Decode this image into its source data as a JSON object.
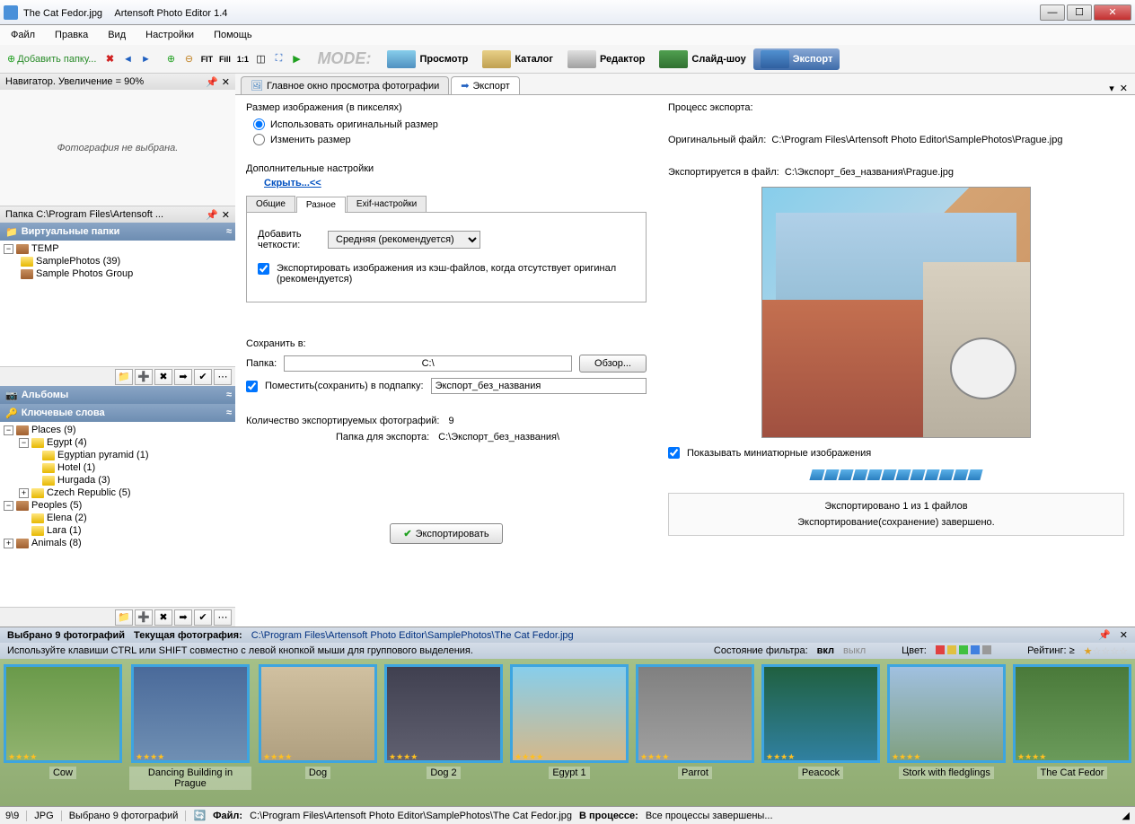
{
  "titlebar": {
    "filename": "The Cat Fedor.jpg",
    "app": "Artensoft Photo Editor 1.4"
  },
  "menu": {
    "file": "Файл",
    "edit": "Правка",
    "view": "Вид",
    "settings": "Настройки",
    "help": "Помощь"
  },
  "toolbar": {
    "add_folder": "Добавить папку...",
    "fit": "FIT",
    "fill": "Fill",
    "scale": "1:1",
    "mode": "MODE:",
    "view_mode": "Просмотр",
    "catalog_mode": "Каталог",
    "editor_mode": "Редактор",
    "slideshow_mode": "Слайд-шоу",
    "export_mode": "Экспорт"
  },
  "navigator": {
    "title": "Навигатор. Увеличение = 90%",
    "empty": "Фотография не выбрана."
  },
  "folders_panel": {
    "title": "Папка C:\\Program Files\\Artensoft ...",
    "virtual": "Виртуальные папки",
    "temp": "TEMP",
    "sample": "SamplePhotos (39)",
    "group": "Sample Photos Group"
  },
  "albums_panel": {
    "title": "Альбомы"
  },
  "keywords_panel": {
    "title": "Ключевые слова",
    "items": {
      "places": "Places (9)",
      "egypt": "Egypt  (4)",
      "pyramid": "Egyptian pyramid  (1)",
      "hotel": "Hotel  (1)",
      "hurgada": "Hurgada  (3)",
      "czech": "Czech Republic  (5)",
      "peoples": "Peoples (5)",
      "elena": "Elena  (2)",
      "lara": "Lara  (1)",
      "animals": "Animals  (8)"
    }
  },
  "tabs": {
    "main_view": "Главное окно просмотра фотографии",
    "export": "Экспорт"
  },
  "export": {
    "size_label": "Размер изображения (в пикселях)",
    "use_original": "Использовать оригинальный размер",
    "resize": "Изменить размер",
    "additional": "Дополнительные настройки",
    "hide": "Скрыть...<<",
    "sub_general": "Общие",
    "sub_misc": "Разное",
    "sub_exif": "Exif-настройки",
    "sharpness_label": "Добавить четкости:",
    "sharpness_value": "Средняя (рекомендуется)",
    "cache_cb": "Экспортировать изображения из кэш-файлов, когда отсутствует оригинал (рекомендуется)",
    "save_to": "Сохранить в:",
    "folder_label": "Папка:",
    "folder_value": "C:\\",
    "browse": "Обзор...",
    "subfolder_cb": "Поместить(сохранить) в подпапку:",
    "subfolder_value": "Экспорт_без_названия",
    "count_label": "Количество экспортируемых фотографий:",
    "count_value": "9",
    "export_folder_label": "Папка для экспорта:",
    "export_folder_value": "C:\\Экспорт_без_названия\\",
    "export_btn": "Экспортировать",
    "process_label": "Процесс экспорта:",
    "orig_file_label": "Оригинальный файл:",
    "orig_file_value": "C:\\Program Files\\Artensoft Photo Editor\\SamplePhotos\\Prague.jpg",
    "export_to_label": "Экспортируется в файл:",
    "export_to_value": "C:\\Экспорт_без_названия\\Prague.jpg",
    "show_thumb_cb": "Показывать миниатюрные изображения",
    "status1": "Экспортировано 1 из 1 файлов",
    "status2": "Экспортирование(сохранение) завершено."
  },
  "infobar": {
    "selected": "Выбрано 9  фотографий",
    "current_label": "Текущая фотография:",
    "current_path": "C:\\Program Files\\Artensoft Photo Editor\\SamplePhotos\\The Cat Fedor.jpg",
    "hint": "Используйте клавиши CTRL или SHIFT совместно с левой кнопкой мыши для группового выделения.",
    "filter_state": "Состояние фильтра:",
    "on": "вкл",
    "off": "выкл",
    "color": "Цвет:",
    "rating": "Рейтинг: ≥"
  },
  "thumbs": [
    {
      "label": "Cow",
      "bg": "linear-gradient(#6a9a4a,#91b36f)"
    },
    {
      "label": "Dancing Building in Prague",
      "bg": "linear-gradient(#4a6a9a,#6f8fb3)"
    },
    {
      "label": "Dog",
      "bg": "linear-gradient(#d0c0a0,#b0a080)"
    },
    {
      "label": "Dog 2",
      "bg": "linear-gradient(#404050,#606070)"
    },
    {
      "label": "Egypt 1",
      "bg": "linear-gradient(#87ceeb,#d4b88a)"
    },
    {
      "label": "Parrot",
      "bg": "linear-gradient(#808080,#a0a0a0)"
    },
    {
      "label": "Peacock",
      "bg": "linear-gradient(#206040,#3080a0)"
    },
    {
      "label": "Stork with fledglings",
      "bg": "linear-gradient(#a0c0e0,#80a080)"
    },
    {
      "label": "The Cat Fedor",
      "bg": "linear-gradient(#4a7a3a,#6a9a5a)"
    }
  ],
  "statusbar": {
    "count": "9\\9",
    "format": "JPG",
    "selected": "Выбрано 9 фотографий",
    "file_label": "Файл:",
    "file_path": "C:\\Program Files\\Artensoft Photo Editor\\SamplePhotos\\The Cat Fedor.jpg",
    "process_label": "В процессе:",
    "process_text": "Все процессы завершены..."
  }
}
